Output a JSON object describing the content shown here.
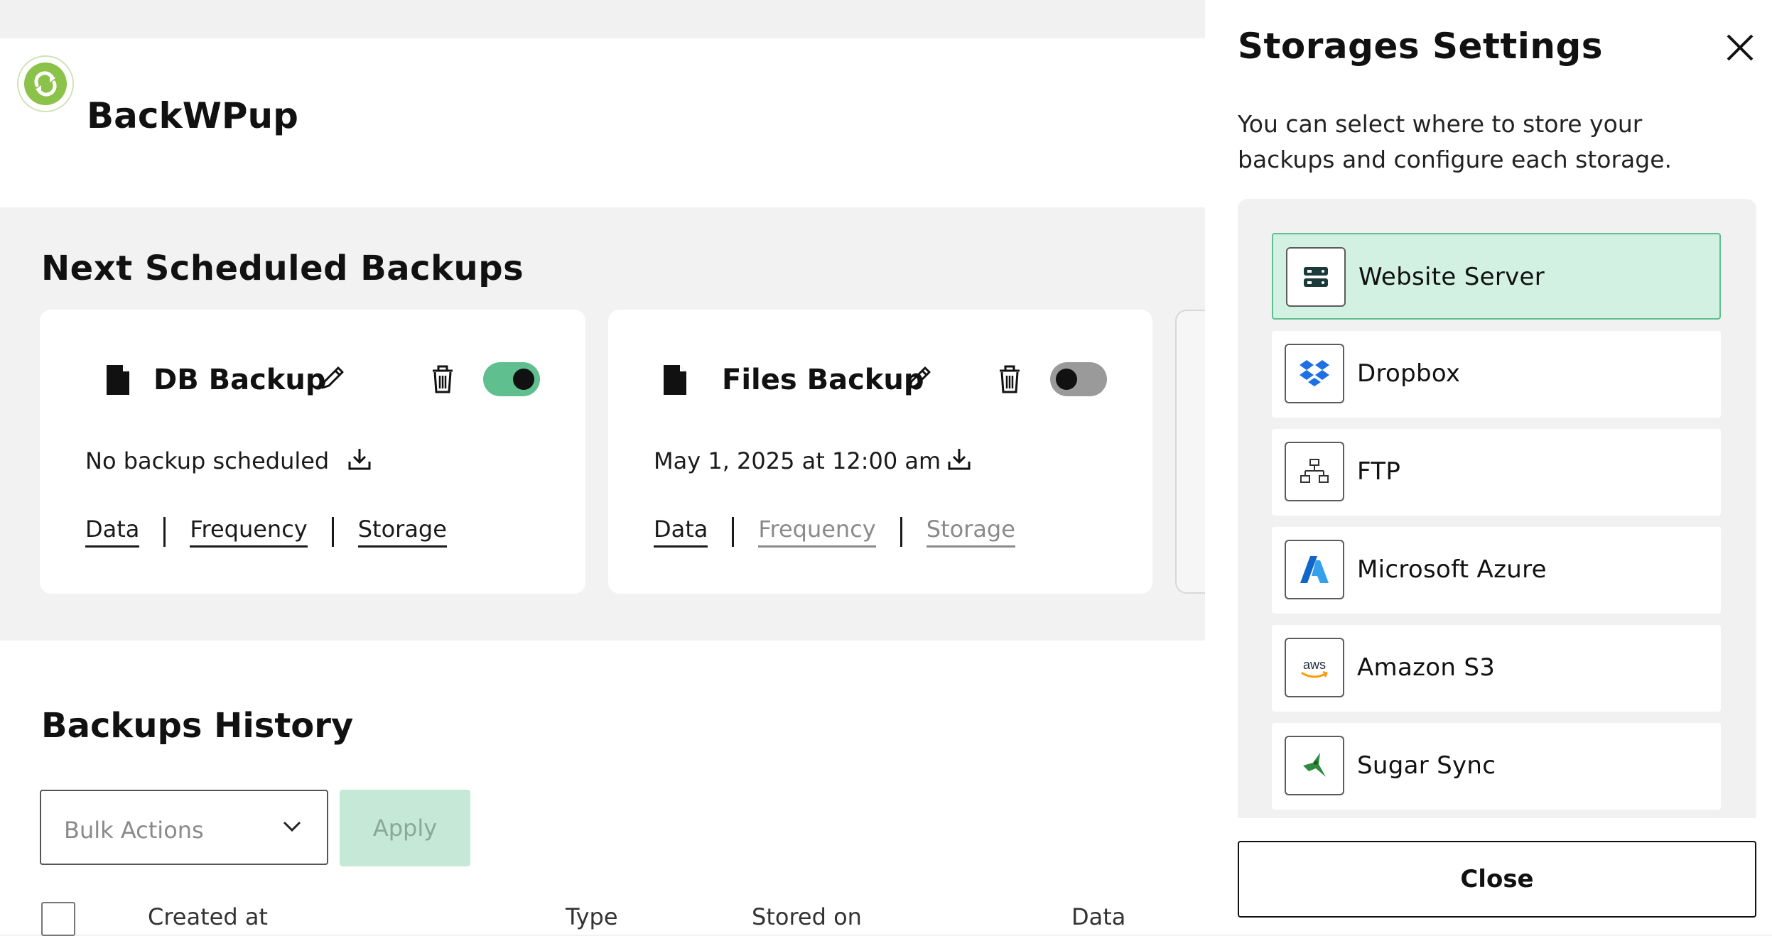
{
  "app": {
    "logo_text": "BackWPup"
  },
  "scheduled": {
    "title": "Next Scheduled Backups",
    "cards": [
      {
        "title": "DB Backup",
        "icon": "file-icon",
        "toggle_on": true,
        "status_text": "No backup scheduled",
        "tabs": [
          {
            "label": "Data",
            "muted": false
          },
          {
            "label": "Frequency",
            "muted": false
          },
          {
            "label": "Storage",
            "muted": false
          }
        ]
      },
      {
        "title": "Files Backup",
        "icon": "file-icon",
        "toggle_on": false,
        "status_text": "May 1, 2025 at 12:00 am",
        "tabs": [
          {
            "label": "Data",
            "muted": false
          },
          {
            "label": "Frequency",
            "muted": true
          },
          {
            "label": "Storage",
            "muted": true
          }
        ]
      }
    ]
  },
  "history": {
    "title": "Backups History",
    "bulk_actions_label": "Bulk Actions",
    "apply_label": "Apply",
    "columns": [
      "Created at",
      "Type",
      "Stored on",
      "Data"
    ]
  },
  "drawer": {
    "title": "Storages Settings",
    "description": "You can select where to store your backups and configure each storage.",
    "storages": [
      {
        "label": "Website Server",
        "icon": "server-icon",
        "active": true
      },
      {
        "label": "Dropbox",
        "icon": "dropbox-icon",
        "active": false
      },
      {
        "label": "FTP",
        "icon": "ftp-network-icon",
        "active": false
      },
      {
        "label": "Microsoft Azure",
        "icon": "azure-icon",
        "active": false
      },
      {
        "label": "Amazon S3",
        "icon": "aws-icon",
        "active": false
      },
      {
        "label": "Sugar Sync",
        "icon": "sugarsync-icon",
        "active": false
      }
    ],
    "close_label": "Close"
  },
  "colors": {
    "accent_green": "#5fbf8f",
    "active_bg": "#d2f1e2",
    "apply_disabled_bg": "#c6e8d6",
    "logo_green": "#8bc34a"
  },
  "icons": {
    "aws_text": "aws"
  }
}
